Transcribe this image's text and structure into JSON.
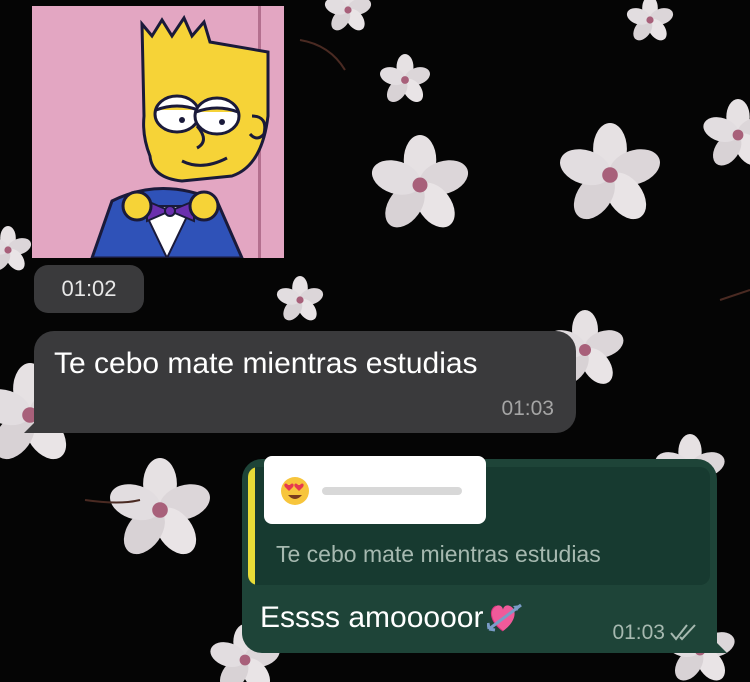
{
  "chat": {
    "sticker_time": "01:02",
    "incoming_message": {
      "text": "Te cebo mate mientras estudias",
      "time": "01:03"
    },
    "outgoing_message": {
      "reply_quote_text": "Te cebo mate mientras estudias",
      "reply_reaction_emoji": "heart-eyes",
      "text": "Essss amooooor",
      "emoji": "heart-with-arrow",
      "time": "01:03",
      "status": "read-double-check"
    }
  },
  "colors": {
    "incoming_bubble": "#3a3a3c",
    "outgoing_bubble": "#1e4438",
    "quote_accent": "#e9dc37",
    "background": "#050505"
  }
}
